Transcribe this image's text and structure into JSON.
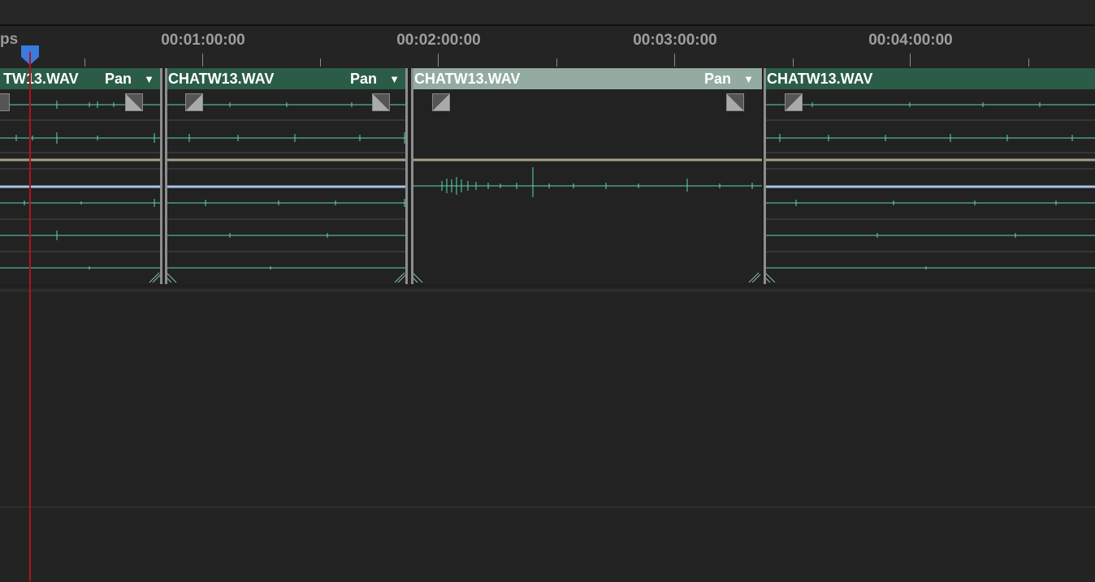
{
  "ruler": {
    "unit_partial": "ps",
    "time_labels": [
      "00:01:00:00",
      "00:02:00:00",
      "00:03:00:00",
      "00:04:00:00"
    ]
  },
  "clips": [
    {
      "name": "TW13.WAV",
      "param": "Pan",
      "selected": false
    },
    {
      "name": "CHATW13.WAV",
      "param": "Pan",
      "selected": false
    },
    {
      "name": "CHATW13.WAV",
      "param": "Pan",
      "selected": true
    },
    {
      "name": "CHATW13.WAV",
      "param": "",
      "selected": false
    }
  ],
  "colors": {
    "clip_header": "#2b5c48",
    "clip_header_selected": "#93aba0",
    "waveform": "#5fd6b4",
    "playhead": "#b3121c",
    "playhead_marker": "#3a7be0",
    "volume_envelope": "#a89f86",
    "pan_envelope": "#a9c3e6"
  },
  "icons": [
    "playhead-marker-icon",
    "fade-in-icon",
    "fade-out-icon",
    "dropdown-arrow-icon",
    "clip-resize-handle-icon"
  ]
}
